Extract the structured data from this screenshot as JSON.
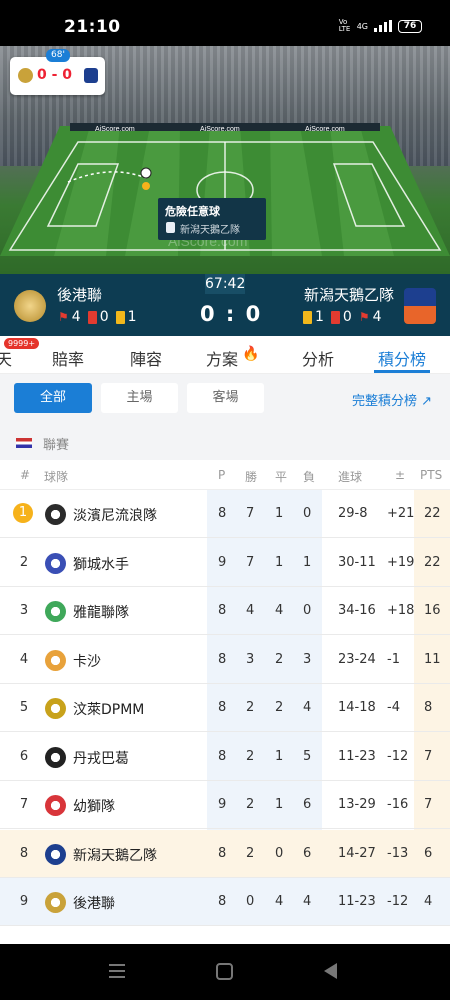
{
  "status_bar": {
    "time": "21:10",
    "network": "4G",
    "volte": "Vo LTE",
    "battery": "76"
  },
  "live_view": {
    "minute": "68'",
    "score": "0 - 0",
    "banner": "AiScore.com",
    "watermark": "AiScore.com",
    "event_title": "危險任意球",
    "event_team": "新潟天鵝乙隊"
  },
  "match": {
    "home": "後港聯",
    "away": "新潟天鵝乙隊",
    "clock": "67:42",
    "score": "0 : 0",
    "home_stats": {
      "corners": "4",
      "red": "0",
      "yellow": "1"
    },
    "away_stats": {
      "yellow": "1",
      "red": "0",
      "corners": "4"
    },
    "colors": {
      "bar": "#0d3c52",
      "yellow_card": "#f2b81c",
      "red_card": "#e23b30",
      "corner_flag": "#e23b30"
    }
  },
  "tabs": {
    "badge": "9999+",
    "first_partial": "天",
    "items": [
      "賠率",
      "陣容",
      "方案",
      "分析",
      "積分榜"
    ],
    "active": "積分榜"
  },
  "filters": {
    "all": "全部",
    "home": "主場",
    "away": "客場",
    "full_table": "完整積分榜"
  },
  "league": {
    "label": "聯賽"
  },
  "table": {
    "headers": {
      "rank": "#",
      "team": "球隊",
      "p": "P",
      "w": "勝",
      "d": "平",
      "l": "負",
      "goals": "進球",
      "diff": "±",
      "pts": "PTS"
    },
    "rows": [
      {
        "rank": "1",
        "team": "淡濱尼流浪隊",
        "p": "8",
        "w": "7",
        "d": "1",
        "l": "0",
        "goals": "29-8",
        "diff": "+21",
        "pts": "22"
      },
      {
        "rank": "2",
        "team": "獅城水手",
        "p": "9",
        "w": "7",
        "d": "1",
        "l": "1",
        "goals": "30-11",
        "diff": "+19",
        "pts": "22"
      },
      {
        "rank": "3",
        "team": "雅龍聯隊",
        "p": "8",
        "w": "4",
        "d": "4",
        "l": "0",
        "goals": "34-16",
        "diff": "+18",
        "pts": "16"
      },
      {
        "rank": "4",
        "team": "卡沙",
        "p": "8",
        "w": "3",
        "d": "2",
        "l": "3",
        "goals": "23-24",
        "diff": "-1",
        "pts": "11"
      },
      {
        "rank": "5",
        "team": "汶萊DPMM",
        "p": "8",
        "w": "2",
        "d": "2",
        "l": "4",
        "goals": "14-18",
        "diff": "-4",
        "pts": "8"
      },
      {
        "rank": "6",
        "team": "丹戎巴葛",
        "p": "8",
        "w": "2",
        "d": "1",
        "l": "5",
        "goals": "11-23",
        "diff": "-12",
        "pts": "7"
      },
      {
        "rank": "7",
        "team": "幼獅隊",
        "p": "9",
        "w": "2",
        "d": "1",
        "l": "6",
        "goals": "13-29",
        "diff": "-16",
        "pts": "7"
      },
      {
        "rank": "8",
        "team": "新潟天鵝乙隊",
        "p": "8",
        "w": "2",
        "d": "0",
        "l": "6",
        "goals": "14-27",
        "diff": "-13",
        "pts": "6"
      },
      {
        "rank": "9",
        "team": "後港聯",
        "p": "8",
        "w": "0",
        "d": "4",
        "l": "4",
        "goals": "11-23",
        "diff": "-12",
        "pts": "4"
      }
    ]
  },
  "colors": {
    "accent": "#1b7ed6",
    "rank1_badge": "#f6b21b",
    "highlight_away": "#fdf4e4",
    "highlight_home": "#eef4fb",
    "stats_col_bg": "#eef4fb",
    "pts_col_bg": "#fdf4e4"
  }
}
